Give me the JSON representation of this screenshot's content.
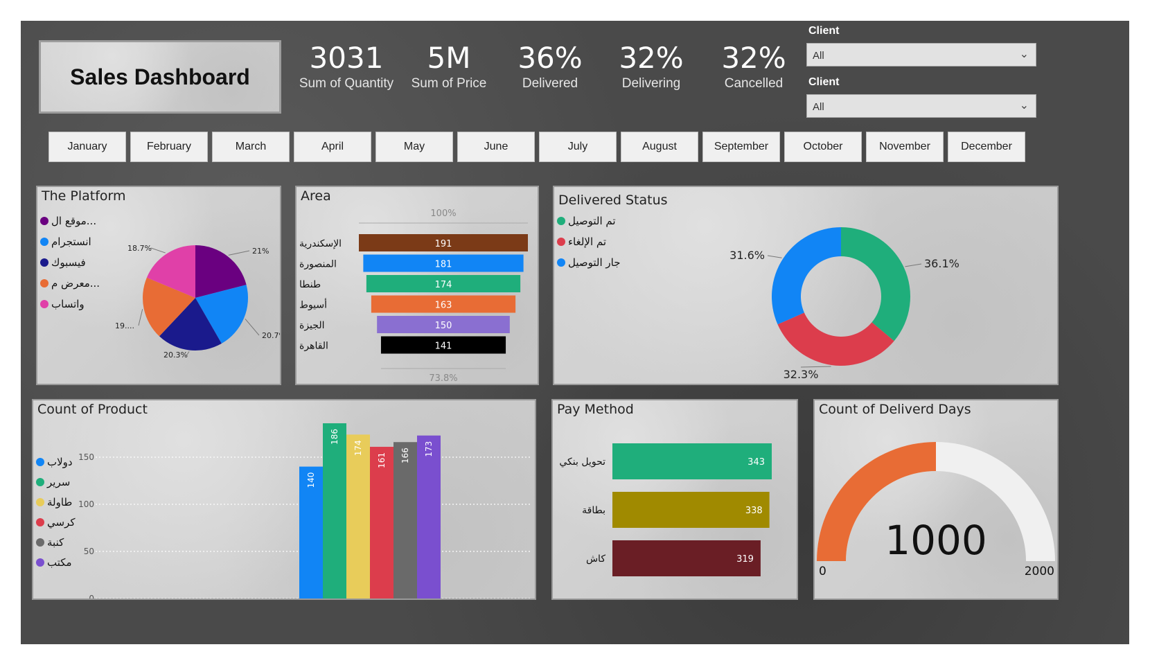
{
  "header": {
    "title": "Sales Dashboard",
    "kpis": [
      {
        "value": "3031",
        "label": "Sum of Quantity"
      },
      {
        "value": "5M",
        "label": "Sum of Price"
      },
      {
        "value": "36%",
        "label": "Delivered"
      },
      {
        "value": "32%",
        "label": "Delivering"
      },
      {
        "value": "32%",
        "label": "Cancelled"
      }
    ],
    "slicers": [
      {
        "label": "Client",
        "value": "All"
      },
      {
        "label": "Client",
        "value": "All"
      }
    ]
  },
  "months": [
    "January",
    "February",
    "March",
    "April",
    "May",
    "June",
    "July",
    "August",
    "September",
    "October",
    "November",
    "December"
  ],
  "platform": {
    "title": "The Platform",
    "legend": [
      {
        "label": "موقع ال...",
        "color": "#6a0080"
      },
      {
        "label": "انستجرام",
        "color": "#1185f5"
      },
      {
        "label": "فيسبوك",
        "color": "#1a1a8c"
      },
      {
        "label": "معرض م...",
        "color": "#e86c35"
      },
      {
        "label": "واتساب",
        "color": "#e040a8"
      }
    ],
    "slice_labels": [
      "21%",
      "20.7%",
      "20.3%",
      "19....",
      "18.7%"
    ]
  },
  "area": {
    "title": "Area",
    "top_label": "100%",
    "bottom_label": "73.8%"
  },
  "delivered": {
    "title": "Delivered Status",
    "legend": [
      {
        "label": "تم التوصيل",
        "color": "#1fae7b"
      },
      {
        "label": "تم الإلغاء",
        "color": "#dc3d4c"
      },
      {
        "label": "جار التوصيل",
        "color": "#1185f5"
      }
    ],
    "slice_labels": [
      "36.1%",
      "32.3%",
      "31.6%"
    ]
  },
  "product": {
    "title": "Count of Product",
    "legend": [
      {
        "label": "دولاب",
        "color": "#1185f5"
      },
      {
        "label": "سرير",
        "color": "#1fae7b"
      },
      {
        "label": "طاولة",
        "color": "#e8cc5a"
      },
      {
        "label": "كرسي",
        "color": "#dc3d4c"
      },
      {
        "label": "كنبة",
        "color": "#6a6a6a"
      },
      {
        "label": "مكتب",
        "color": "#7a4fcf"
      }
    ],
    "ticks": [
      "150",
      "100",
      "50",
      "0"
    ]
  },
  "pay": {
    "title": "Pay Method"
  },
  "gauge": {
    "title": "Count of Deliverd Days",
    "value_label": "1000",
    "min_label": "0",
    "max_label": "2000",
    "value": 1000,
    "min": 0,
    "max": 2000,
    "fill_color": "#e86c35",
    "track_color": "#f0f0f0"
  },
  "chart_data": [
    {
      "type": "pie",
      "categories": [
        "موقع ال...",
        "انستجرام",
        "فيسبوك",
        "معرض م...",
        "واتساب"
      ],
      "values": [
        21,
        20.7,
        20.3,
        19.3,
        18.7
      ],
      "colors": [
        "#6a0080",
        "#1185f5",
        "#1a1a8c",
        "#e86c35",
        "#e040a8"
      ]
    },
    {
      "type": "bar",
      "categories": [
        "الإسكندرية",
        "المنصورة",
        "طنطا",
        "أسيوط",
        "الجيزة",
        "القاهرة"
      ],
      "values": [
        191,
        181,
        174,
        163,
        150,
        141
      ],
      "colors": [
        "#7b3a17",
        "#1185f5",
        "#1fae7b",
        "#e86c35",
        "#8a6fd1",
        "#000000"
      ]
    },
    {
      "type": "pie",
      "categories": [
        "تم التوصيل",
        "تم الإلغاء",
        "جار التوصيل"
      ],
      "values": [
        36.1,
        32.3,
        31.6
      ],
      "colors": [
        "#1fae7b",
        "#dc3d4c",
        "#1185f5"
      ]
    },
    {
      "type": "bar",
      "categories": [
        "دولاب",
        "سرير",
        "طاولة",
        "كرسي",
        "كنبة",
        "مكتب"
      ],
      "values": [
        140,
        186,
        174,
        161,
        166,
        173
      ],
      "colors": [
        "#1185f5",
        "#1fae7b",
        "#e8cc5a",
        "#dc3d4c",
        "#6a6a6a",
        "#7a4fcf"
      ],
      "ylim": [
        0,
        200
      ]
    },
    {
      "type": "bar",
      "categories": [
        "تحويل بنكي",
        "بطاقة",
        "كاش"
      ],
      "values": [
        343,
        338,
        319
      ],
      "colors": [
        "#1fae7b",
        "#a08a00",
        "#6a1e25"
      ]
    }
  ]
}
